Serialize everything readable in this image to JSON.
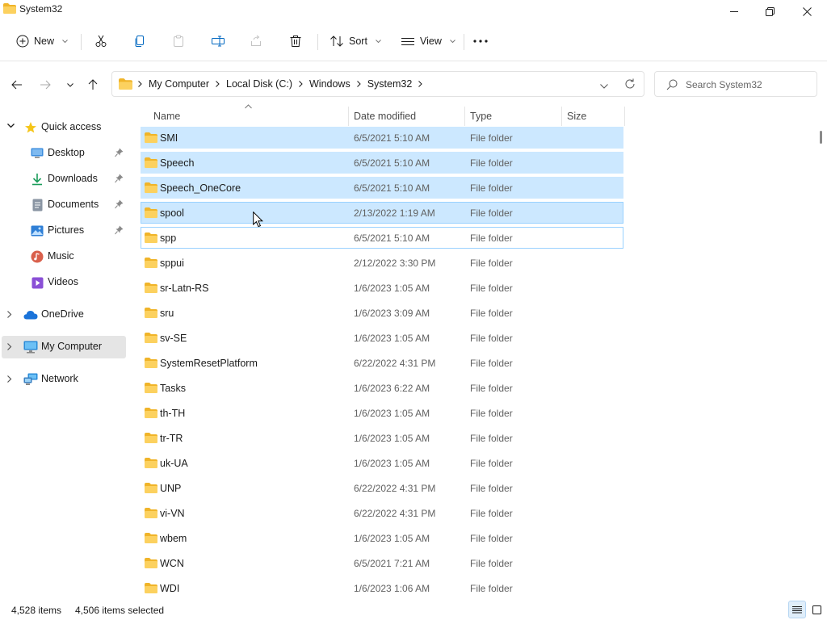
{
  "window": {
    "title": "System32"
  },
  "commandbar": {
    "new_label": "New",
    "sort_label": "Sort",
    "view_label": "View"
  },
  "address": {
    "crumbs": [
      "My Computer",
      "Local Disk (C:)",
      "Windows",
      "System32"
    ]
  },
  "search": {
    "placeholder": "Search System32"
  },
  "sidebar": {
    "quick_access": "Quick access",
    "items": [
      {
        "label": "Desktop",
        "icon": "desktop-icon",
        "pinned": true
      },
      {
        "label": "Downloads",
        "icon": "downloads-icon",
        "pinned": true
      },
      {
        "label": "Documents",
        "icon": "documents-icon",
        "pinned": true
      },
      {
        "label": "Pictures",
        "icon": "pictures-icon",
        "pinned": true
      },
      {
        "label": "Music",
        "icon": "music-icon",
        "pinned": false
      },
      {
        "label": "Videos",
        "icon": "videos-icon",
        "pinned": false
      }
    ],
    "onedrive": "OneDrive",
    "mycomputer": "My Computer",
    "network": "Network"
  },
  "columns": {
    "name": "Name",
    "date": "Date modified",
    "type": "Type",
    "size": "Size"
  },
  "files": [
    {
      "name": "SMI",
      "date": "6/5/2021 5:10 AM",
      "type": "File folder",
      "state": "selected"
    },
    {
      "name": "Speech",
      "date": "6/5/2021 5:10 AM",
      "type": "File folder",
      "state": "selected"
    },
    {
      "name": "Speech_OneCore",
      "date": "6/5/2021 5:10 AM",
      "type": "File folder",
      "state": "selected"
    },
    {
      "name": "spool",
      "date": "2/13/2022 1:19 AM",
      "type": "File folder",
      "state": "hover"
    },
    {
      "name": "spp",
      "date": "6/5/2021 5:10 AM",
      "type": "File folder",
      "state": "focus"
    },
    {
      "name": "sppui",
      "date": "2/12/2022 3:30 PM",
      "type": "File folder",
      "state": ""
    },
    {
      "name": "sr-Latn-RS",
      "date": "1/6/2023 1:05 AM",
      "type": "File folder",
      "state": ""
    },
    {
      "name": "sru",
      "date": "1/6/2023 3:09 AM",
      "type": "File folder",
      "state": ""
    },
    {
      "name": "sv-SE",
      "date": "1/6/2023 1:05 AM",
      "type": "File folder",
      "state": ""
    },
    {
      "name": "SystemResetPlatform",
      "date": "6/22/2022 4:31 PM",
      "type": "File folder",
      "state": ""
    },
    {
      "name": "Tasks",
      "date": "1/6/2023 6:22 AM",
      "type": "File folder",
      "state": ""
    },
    {
      "name": "th-TH",
      "date": "1/6/2023 1:05 AM",
      "type": "File folder",
      "state": ""
    },
    {
      "name": "tr-TR",
      "date": "1/6/2023 1:05 AM",
      "type": "File folder",
      "state": ""
    },
    {
      "name": "uk-UA",
      "date": "1/6/2023 1:05 AM",
      "type": "File folder",
      "state": ""
    },
    {
      "name": "UNP",
      "date": "6/22/2022 4:31 PM",
      "type": "File folder",
      "state": ""
    },
    {
      "name": "vi-VN",
      "date": "6/22/2022 4:31 PM",
      "type": "File folder",
      "state": ""
    },
    {
      "name": "wbem",
      "date": "1/6/2023 1:05 AM",
      "type": "File folder",
      "state": ""
    },
    {
      "name": "WCN",
      "date": "6/5/2021 7:21 AM",
      "type": "File folder",
      "state": ""
    },
    {
      "name": "WDI",
      "date": "1/6/2023 1:06 AM",
      "type": "File folder",
      "state": ""
    }
  ],
  "status": {
    "items": "4,528 items",
    "selected": "4,506 items selected"
  },
  "colors": {
    "selection": "#cce8ff",
    "selection_border": "#99d1ff",
    "folder": "#f5c04a",
    "accent": "#0067c0"
  }
}
